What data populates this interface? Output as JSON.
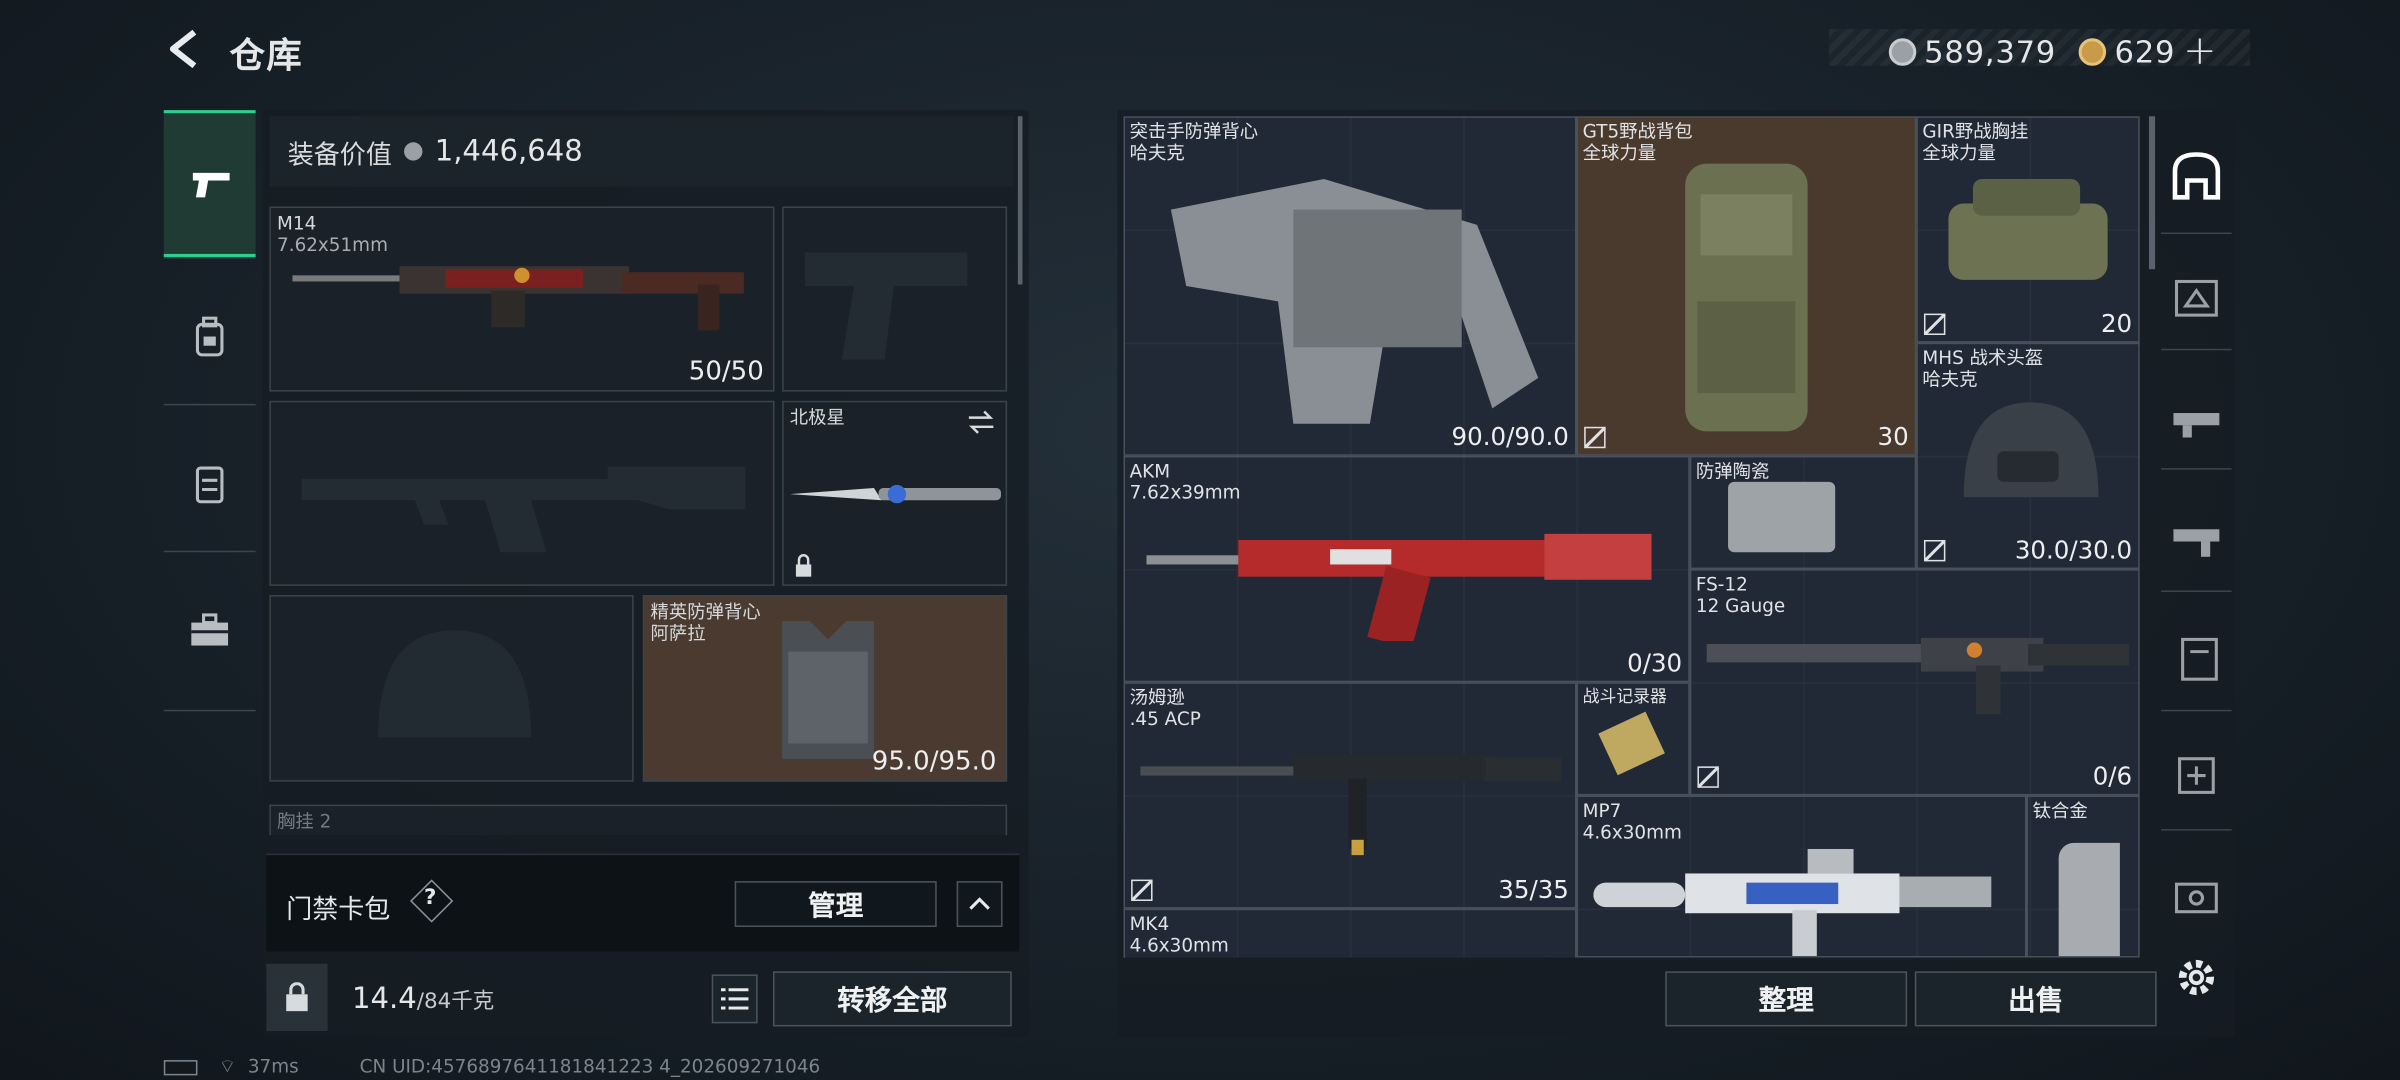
{
  "header": {
    "title": "仓库",
    "currency1": "589,379",
    "currency2": "629",
    "plus": "+"
  },
  "left": {
    "equip_value_label": "装备价值",
    "equip_value": "1,446,648",
    "slots": {
      "primary": {
        "name": "M14",
        "caliber": "7.62x51mm",
        "ammo": "50/50"
      },
      "melee": {
        "name": "北极星"
      },
      "armor": {
        "name": "精英防弹背心",
        "brand": "阿萨拉",
        "durability": "95.0/95.0"
      },
      "chest_partial": "胸挂 2"
    },
    "card_pack": {
      "label": "门禁卡包",
      "help": "?",
      "manage": "管理"
    },
    "weight": {
      "current": "14.4",
      "max": "/84千克"
    },
    "transfer_all": "转移全部"
  },
  "stash": {
    "items": [
      {
        "name": "突击手防弹背心",
        "brand": "哈夫克",
        "count": "90.0/90.0"
      },
      {
        "name": "GT5野战背包",
        "brand": "全球力量",
        "count": "30"
      },
      {
        "name": "GIR野战胸挂",
        "brand": "全球力量",
        "count": "20"
      },
      {
        "name": "MHS 战术头盔",
        "brand": "哈夫克",
        "count": "30.0/30.0"
      },
      {
        "name": "AKM",
        "brand": "7.62x39mm",
        "count": "0/30"
      },
      {
        "name": "防弹陶瓷",
        "brand": "",
        "count": ""
      },
      {
        "name": "FS-12",
        "brand": "12 Gauge",
        "count": "0/6"
      },
      {
        "name": "汤姆逊",
        "brand": ".45 ACP",
        "count": "35/35"
      },
      {
        "name": "战斗记录器",
        "brand": "",
        "count": ""
      },
      {
        "name": "MP7",
        "brand": "4.6x30mm",
        "count": ""
      },
      {
        "name": "钛合金",
        "brand": "",
        "count": ""
      },
      {
        "name": "MK4",
        "brand": "4.6x30mm",
        "count": ""
      }
    ],
    "sort": "整理",
    "sell": "出售"
  },
  "status": {
    "ping": "37ms",
    "uid": "CN UID:4576897641181841223 4_202609271046"
  }
}
